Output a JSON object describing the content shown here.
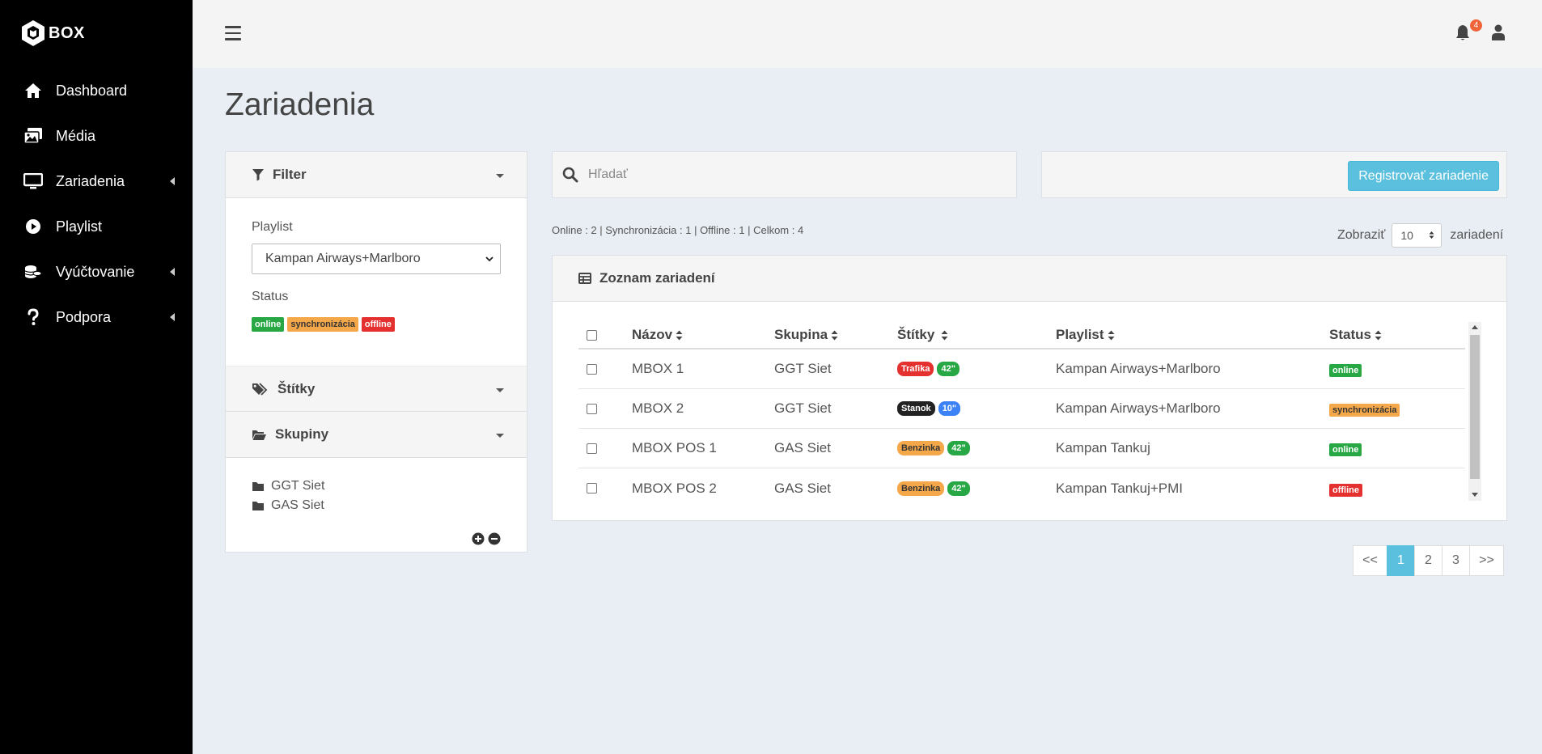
{
  "brand": {
    "logo_text": "BOX"
  },
  "sidebar": {
    "items": [
      {
        "label": "Dashboard",
        "icon": "home-icon",
        "has_submenu": false
      },
      {
        "label": "Média",
        "icon": "images-icon",
        "has_submenu": false
      },
      {
        "label": "Zariadenia",
        "icon": "monitor-icon",
        "has_submenu": true
      },
      {
        "label": "Playlist",
        "icon": "play-circle-icon",
        "has_submenu": false
      },
      {
        "label": "Vyúčtovanie",
        "icon": "coins-icon",
        "has_submenu": true
      },
      {
        "label": "Podpora",
        "icon": "question-icon",
        "has_submenu": true
      }
    ]
  },
  "topbar": {
    "notification_count": "4"
  },
  "page": {
    "title": "Zariadenia"
  },
  "filter": {
    "title": "Filter",
    "playlist_label": "Playlist",
    "playlist_selected": "Kampan Airways+Marlboro",
    "status_label": "Status",
    "status_tags": [
      "online",
      "synchronizácia",
      "offline"
    ],
    "tags_title": "Štítky",
    "groups_title": "Skupiny",
    "groups": [
      "GGT Siet",
      "GAS Siet"
    ]
  },
  "search": {
    "placeholder": "Hľadať"
  },
  "register": {
    "label": "Registrovať zariadenie"
  },
  "summary": {
    "text": "Online : 2 | Synchronizácia : 1 | Offline : 1 | Celkom : 4"
  },
  "show": {
    "label_before": "Zobraziť",
    "value": "10",
    "label_after": "zariadení"
  },
  "device_list": {
    "title": "Zoznam zariadení",
    "columns": [
      "Názov",
      "Skupina",
      "Štítky",
      "Playlist",
      "Status"
    ],
    "rows": [
      {
        "name": "MBOX 1",
        "group": "GGT Siet",
        "tags": [
          "Trafika",
          "42\""
        ],
        "playlist": "Kampan Airways+Marlboro",
        "status": "online"
      },
      {
        "name": "MBOX 2",
        "group": "GGT Siet",
        "tags": [
          "Stanok",
          "10\""
        ],
        "playlist": "Kampan Airways+Marlboro",
        "status": "synchronizácia"
      },
      {
        "name": "MBOX POS 1",
        "group": "GAS Siet",
        "tags": [
          "Benzinka",
          "42\""
        ],
        "playlist": "Kampan Tankuj",
        "status": "online"
      },
      {
        "name": "MBOX POS 2",
        "group": "GAS Siet",
        "tags": [
          "Benzinka",
          "42\""
        ],
        "playlist": "Kampan Tankuj+PMI",
        "status": "offline"
      }
    ]
  },
  "pagination": {
    "prev": "<<",
    "pages": [
      "1",
      "2",
      "3"
    ],
    "next": ">>",
    "active": "1"
  },
  "colors": {
    "accent": "#5bc0de",
    "online": "#28a745",
    "sync": "#f5a84a",
    "offline": "#e4312f",
    "sidebar": "#000000"
  }
}
